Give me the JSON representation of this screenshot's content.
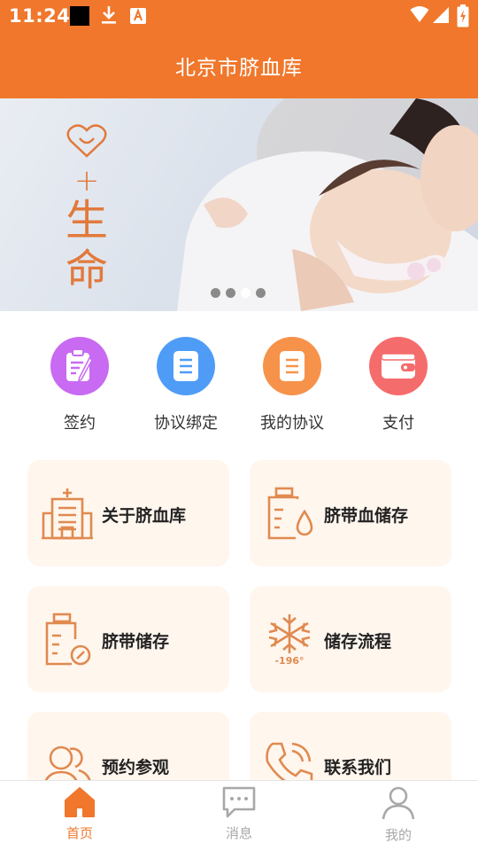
{
  "status_bar": {
    "time": "11:24"
  },
  "header": {
    "title": "北京市脐血库"
  },
  "banner": {
    "tag_plus": "+",
    "tag_word_1": "生",
    "tag_word_2": "命",
    "slide_count": 4,
    "active_slide": 3
  },
  "quick_actions": [
    {
      "label": "签约",
      "icon": "contract-sign-icon",
      "color": "#c86af2"
    },
    {
      "label": "协议绑定",
      "icon": "document-icon",
      "color": "#4f9cf7"
    },
    {
      "label": "我的协议",
      "icon": "document-icon",
      "color": "#f7924a"
    },
    {
      "label": "支付",
      "icon": "wallet-icon",
      "color": "#f56c6c"
    }
  ],
  "cards": [
    {
      "label": "关于脐血库",
      "icon": "hospital-icon"
    },
    {
      "label": "脐带血储存",
      "icon": "blood-storage-icon"
    },
    {
      "label": "脐带储存",
      "icon": "cord-storage-icon"
    },
    {
      "label": "储存流程",
      "icon": "snowflake-icon",
      "icon_text": "-196°"
    },
    {
      "label": "预约参观",
      "icon": "people-icon"
    },
    {
      "label": "联系我们",
      "icon": "phone-icon"
    }
  ],
  "tabbar": [
    {
      "label": "首页",
      "icon": "home-icon",
      "active": true
    },
    {
      "label": "消息",
      "icon": "message-icon",
      "active": false
    },
    {
      "label": "我的",
      "icon": "user-icon",
      "active": false
    }
  ],
  "colors": {
    "brand": "#f0772b",
    "card_bg": "#fff6ee",
    "card_icon": "#e08a50",
    "tab_inactive": "#a8a8a8"
  }
}
